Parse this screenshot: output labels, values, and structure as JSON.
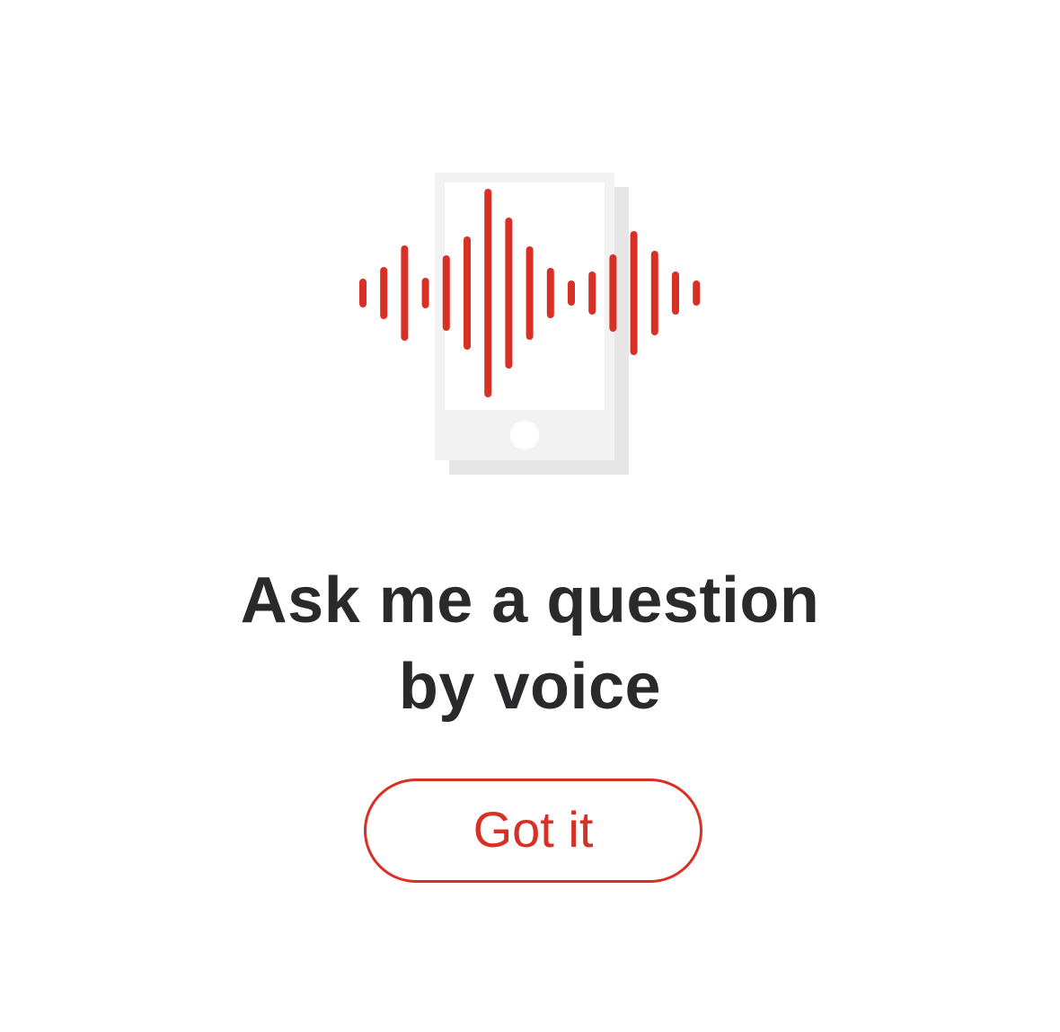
{
  "intro": {
    "headline_line1": "Ask me a question",
    "headline_line2": "by voice",
    "button_label": "Got it"
  },
  "icons": {
    "illustration": "phone-voice-waveform-icon"
  },
  "colors": {
    "accent": "#d93025",
    "text": "#2a2a2c",
    "phone_body": "#f2f2f2",
    "phone_shadow": "#e6e6e6",
    "background": "#ffffff"
  }
}
